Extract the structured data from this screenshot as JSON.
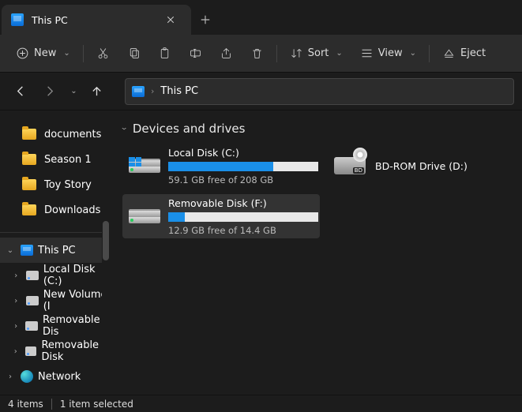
{
  "tab": {
    "title": "This PC"
  },
  "toolbar": {
    "new": "New",
    "sort": "Sort",
    "view": "View",
    "eject": "Eject"
  },
  "breadcrumb": {
    "root": "This PC"
  },
  "quick_access": [
    {
      "label": "documents"
    },
    {
      "label": "Season 1"
    },
    {
      "label": "Toy Story"
    },
    {
      "label": "Downloads"
    }
  ],
  "tree": {
    "this_pc": "This PC",
    "children": [
      "Local Disk (C:)",
      "New Volume (I",
      "Removable Dis",
      "Removable Disk"
    ],
    "network": "Network"
  },
  "group": {
    "title": "Devices and drives"
  },
  "drives": [
    {
      "name": "Local Disk (C:)",
      "free": "59.1 GB free of 208 GB",
      "fill": 70,
      "type": "os",
      "selected": false
    },
    {
      "name": "BD-ROM Drive (D:)",
      "type": "bd"
    },
    {
      "name": "Removable Disk (F:)",
      "free": "12.9 GB free of 14.4 GB",
      "fill": 11,
      "type": "removable",
      "selected": true
    }
  ],
  "status": {
    "count": "4 items",
    "selection": "1 item selected"
  }
}
